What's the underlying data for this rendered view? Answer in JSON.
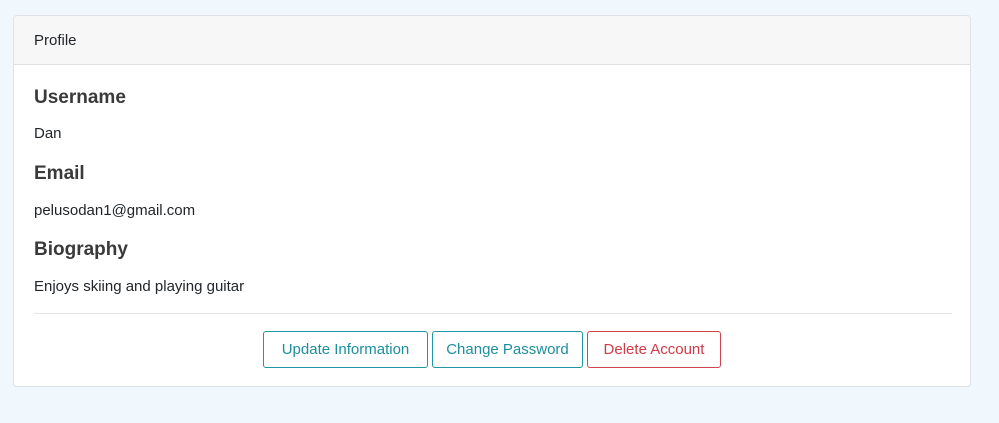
{
  "card": {
    "header_title": "Profile"
  },
  "fields": [
    {
      "label": "Username",
      "value": "Dan"
    },
    {
      "label": "Email",
      "value": "pelusodan1@gmail.com"
    },
    {
      "label": "Biography",
      "value": "Enjoys skiing and playing guitar"
    }
  ],
  "actions": {
    "update_label": "Update Information",
    "password_label": "Change Password",
    "delete_label": "Delete Account"
  },
  "colors": {
    "page_background": "#f0f7fd",
    "info_outline": "#1d97a3",
    "danger_outline": "#d2434f"
  }
}
